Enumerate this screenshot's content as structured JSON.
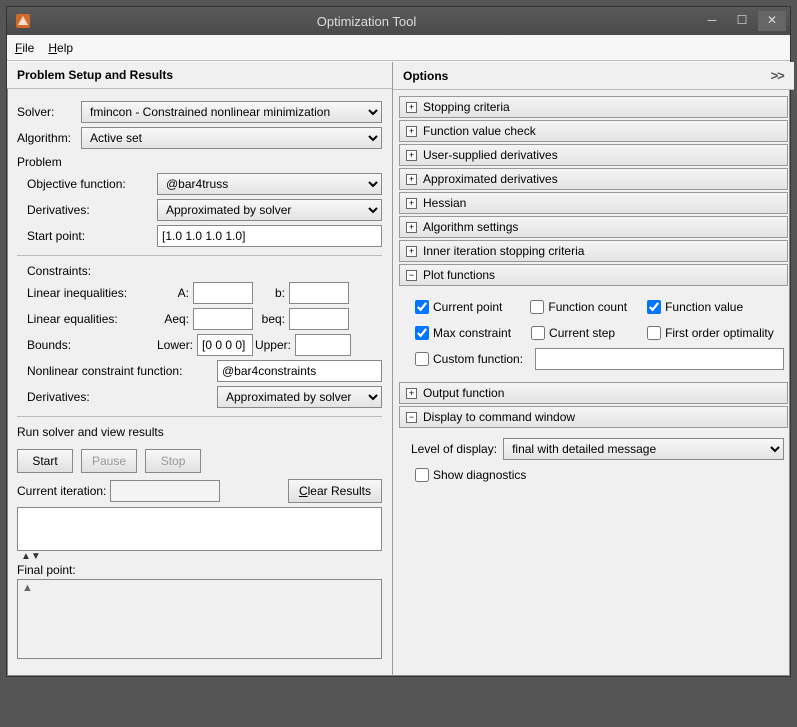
{
  "window": {
    "title": "Optimization Tool"
  },
  "menubar": {
    "file": "File",
    "help": "Help"
  },
  "left": {
    "header": "Problem Setup and Results",
    "solver_label": "Solver:",
    "solver_value": "fmincon - Constrained nonlinear minimization",
    "algorithm_label": "Algorithm:",
    "algorithm_value": "Active set",
    "problem_label": "Problem",
    "objfun_label": "Objective function:",
    "objfun_value": "@bar4truss",
    "derivatives_label": "Derivatives:",
    "derivatives_value": "Approximated by solver",
    "startpoint_label": "Start point:",
    "startpoint_value": "[1.0 1.0 1.0 1.0]",
    "constraints_label": "Constraints:",
    "linineq_label": "Linear inequalities:",
    "A_label": "A:",
    "b_label": "b:",
    "lineq_label": "Linear equalities:",
    "Aeq_label": "Aeq:",
    "beq_label": "beq:",
    "bounds_label": "Bounds:",
    "lower_label": "Lower:",
    "lower_value": "[0 0 0 0]",
    "upper_label": "Upper:",
    "nonlin_label": "Nonlinear constraint function:",
    "nonlin_value": "@bar4constraints",
    "derivatives2_label": "Derivatives:",
    "derivatives2_value": "Approximated by solver",
    "runsolver_label": "Run solver and view results",
    "start_btn": "Start",
    "pause_btn": "Pause",
    "stop_btn": "Stop",
    "curiter_label": "Current iteration:",
    "clear_btn": "Clear Results",
    "finalpoint_label": "Final point:"
  },
  "right": {
    "header": "Options",
    "more": ">>",
    "acc": {
      "stopping": "Stopping criteria",
      "funccheck": "Function value check",
      "userderiv": "User-supplied derivatives",
      "approxderiv": "Approximated derivatives",
      "hessian": "Hessian",
      "algosettings": "Algorithm settings",
      "inneriter": "Inner iteration stopping criteria",
      "plotfuncs": "Plot functions",
      "outputfunc": "Output function",
      "displaycmd": "Display to command window"
    },
    "plot": {
      "currentpoint": "Current point",
      "funccount": "Function count",
      "funcvalue": "Function value",
      "maxconstraint": "Max constraint",
      "currentstep": "Current step",
      "firstorder": "First order optimality",
      "customfunc": "Custom function:"
    },
    "display": {
      "level_label": "Level of display:",
      "level_value": "final with detailed message",
      "showdiag": "Show diagnostics"
    }
  }
}
